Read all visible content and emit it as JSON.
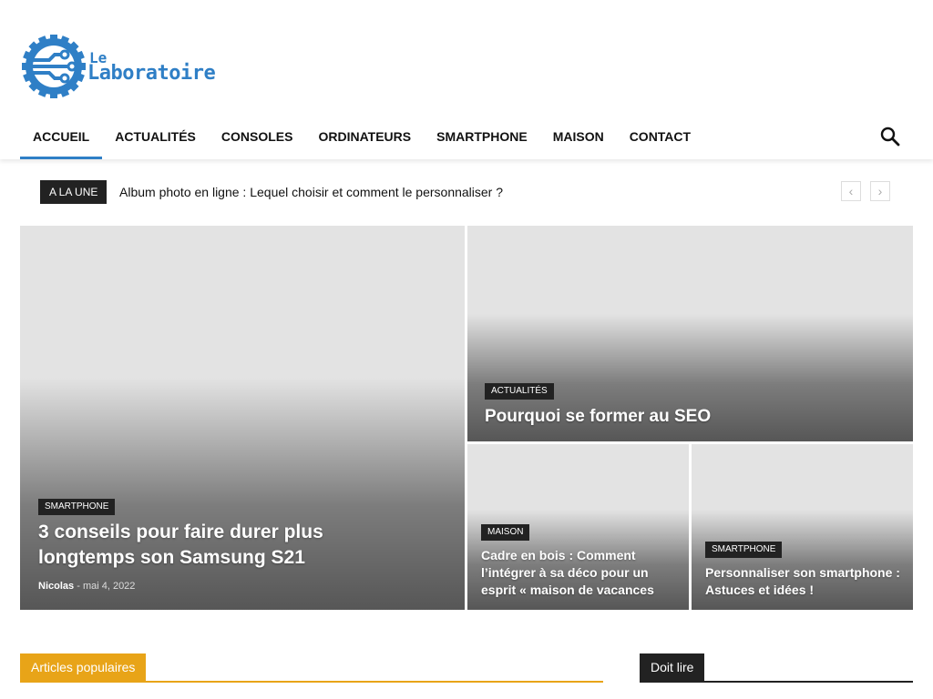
{
  "site": {
    "logo_le": "Le",
    "logo_name": "Laboratoire",
    "brand_color": "#2f7fc6"
  },
  "nav": {
    "items": [
      {
        "label": "ACCUEIL",
        "active": true
      },
      {
        "label": "ACTUALITÉS"
      },
      {
        "label": "CONSOLES"
      },
      {
        "label": "ORDINATEURS"
      },
      {
        "label": "SMARTPHONE"
      },
      {
        "label": "MAISON"
      },
      {
        "label": "CONTACT"
      }
    ],
    "search_icon": "search-icon"
  },
  "ticker": {
    "label": "A LA UNE",
    "headline": "Album photo en ligne : Lequel choisir et comment le personnaliser ?",
    "prev": "‹",
    "next": "›"
  },
  "featured": {
    "main": {
      "category": "SMARTPHONE",
      "title": "3 conseils pour faire durer plus longtemps son Samsung S21",
      "author": "Nicolas",
      "separator": "-",
      "date": "mai 4, 2022"
    },
    "top_right": {
      "category": "ACTUALITÉS",
      "title": "Pourquoi se former au SEO"
    },
    "bottom_left": {
      "category": "MAISON",
      "title": "Cadre en bois : Comment l’intégrer à sa déco pour un esprit « maison de vacances"
    },
    "bottom_right": {
      "category": "SMARTPHONE",
      "title": "Personnaliser son smartphone : Astuces et idées !"
    }
  },
  "sections": {
    "popular": {
      "label": "Articles populaires",
      "color": "#e8a418"
    },
    "must_read": {
      "label": "Doit lire",
      "color": "#222222"
    }
  }
}
